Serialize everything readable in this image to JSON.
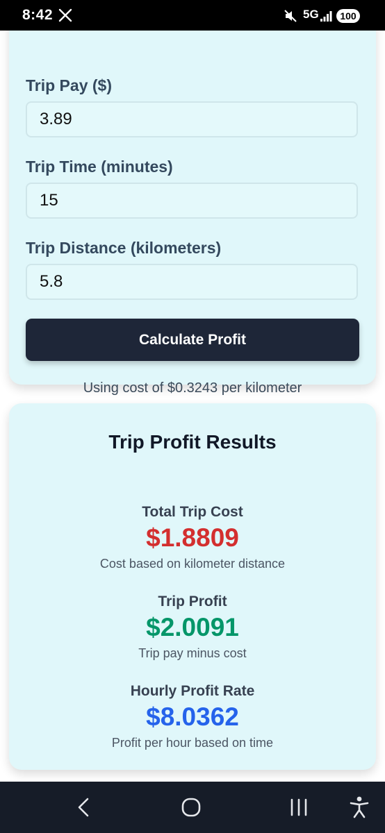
{
  "status_bar": {
    "time": "8:42",
    "network": "5G",
    "battery": "100",
    "icons": [
      "x-app-icon",
      "mute-icon",
      "signal-icon",
      "battery-icon"
    ]
  },
  "form": {
    "trip_pay": {
      "label": "Trip Pay ($)",
      "value": "3.89"
    },
    "trip_time": {
      "label": "Trip Time (minutes)",
      "value": "15"
    },
    "trip_distance": {
      "label": "Trip Distance (kilometers)",
      "value": "5.8"
    },
    "calculate_label": "Calculate Profit",
    "cost_note": "Using cost of $0.3243 per kilometer"
  },
  "results": {
    "title": "Trip Profit Results",
    "total_cost": {
      "label": "Total Trip Cost",
      "value": "$1.8809",
      "desc": "Cost based on kilometer distance",
      "color": "#d32f2f"
    },
    "profit": {
      "label": "Trip Profit",
      "value": "$2.0091",
      "desc": "Trip pay minus cost",
      "color": "#059669"
    },
    "hourly": {
      "label": "Hourly Profit Rate",
      "value": "$8.0362",
      "desc": "Profit per hour based on time",
      "color": "#2563eb"
    }
  },
  "nav_bar": {
    "icons": [
      "back-icon",
      "home-icon",
      "recents-icon",
      "accessibility-icon"
    ]
  },
  "colors": {
    "card_background": "#e0f7fa",
    "button_background": "#1e2638"
  }
}
